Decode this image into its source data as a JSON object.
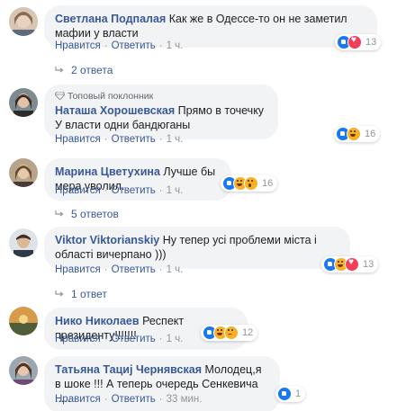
{
  "labels": {
    "like": "Нравится",
    "reply": "Ответить",
    "sep": "·"
  },
  "comments": [
    {
      "author": "Светлана Подпалая",
      "text": "Как же в Одессе-то он не заметил мафии у власти",
      "time": "1 ч.",
      "reaction_count": "13",
      "reactions": [
        "like",
        "love"
      ],
      "replies": "2 ответа"
    },
    {
      "badge": "Топовый поклонник",
      "author": "Наташа Хорошевская",
      "text": "Прямо в точечку У власти одни бандюганы",
      "time": "1 ч.",
      "reaction_count": "16",
      "reactions": [
        "like",
        "haha"
      ]
    },
    {
      "author": "Марина Цветухина",
      "text": "Лучше бы мера уволил.",
      "time": "1 ч.",
      "reaction_count": "16",
      "reactions": [
        "like",
        "haha",
        "wow"
      ],
      "replies": "5 ответов"
    },
    {
      "author": "Viktor Viktorianskiy",
      "text": "Ну тепер усі проблеми міста і області вичерпано )))",
      "time": "1 ч.",
      "reaction_count": "13",
      "reactions": [
        "like",
        "haha",
        "love"
      ],
      "replies": "1 ответ"
    },
    {
      "author": "Нико Николаев",
      "text": "Респект президенту!!!!!!!",
      "time": "1 ч.",
      "reaction_count": "12",
      "reactions": [
        "like",
        "haha",
        "sad"
      ]
    },
    {
      "author": "Татьяна Тациј Чернявская",
      "text": "Молодец,я в шоке !!! А теперь очередь Сенкевича .....",
      "time": "33 мин.",
      "reaction_count": "1",
      "reactions": [
        "like"
      ]
    }
  ],
  "colors": {
    "link": "#385898",
    "bubble": "#f2f3f5",
    "meta": "#90949c",
    "like": "#1877f2",
    "love": "#f33e58",
    "haha": "#f7b125"
  }
}
